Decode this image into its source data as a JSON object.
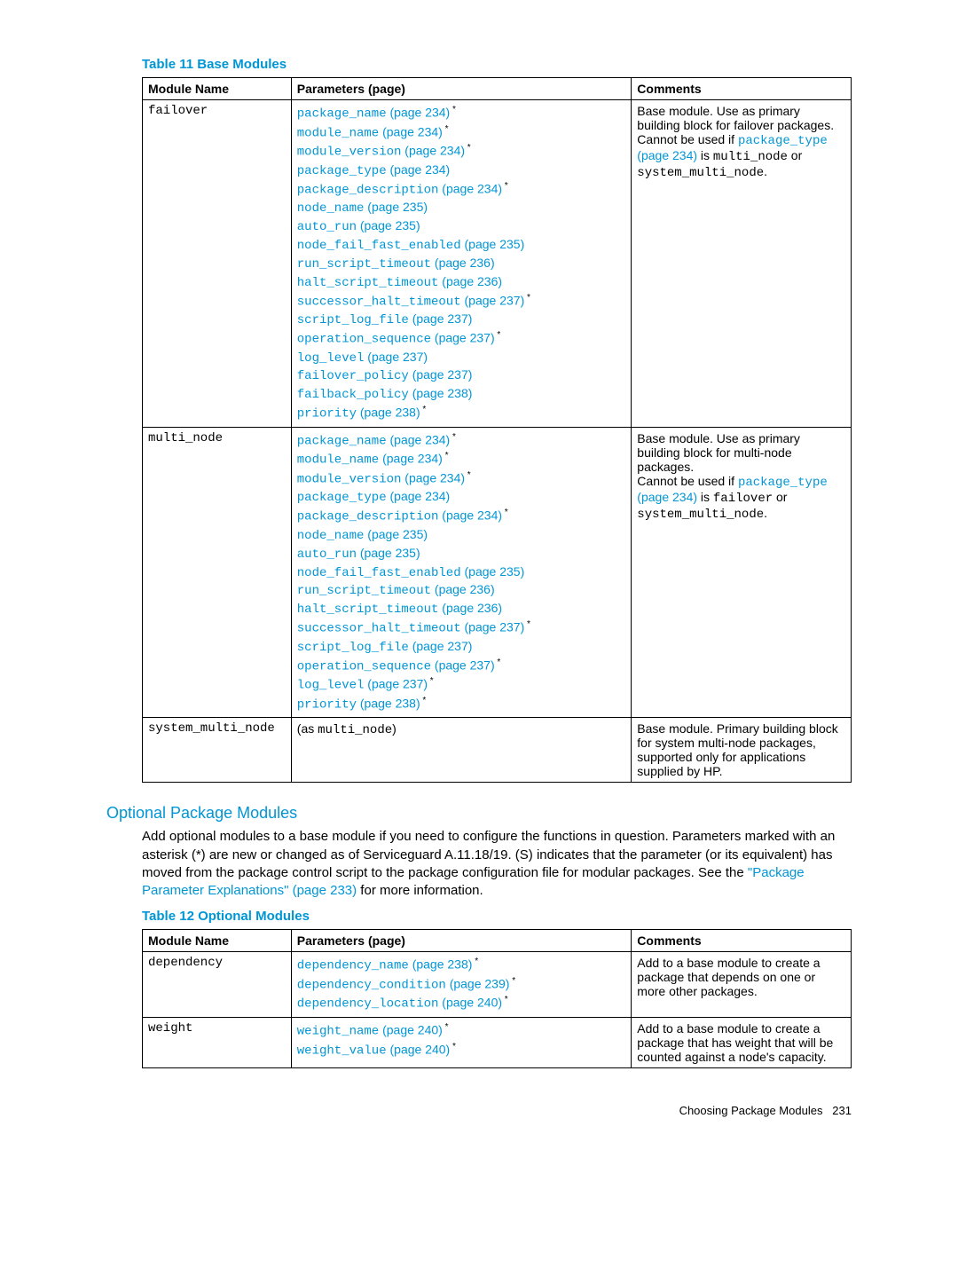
{
  "table11": {
    "title": "Table 11 Base Modules",
    "headers": [
      "Module Name",
      "Parameters (page)",
      "Comments"
    ],
    "rows": {
      "failover": {
        "module": "failover",
        "params": [
          {
            "name": "package_name",
            "page": "234",
            "star": true
          },
          {
            "name": "module_name",
            "page": "234",
            "star": true
          },
          {
            "name": "module_version",
            "page": "234",
            "star": true
          },
          {
            "name": "package_type",
            "page": "234"
          },
          {
            "name": "package_description",
            "page": "234",
            "star": true
          },
          {
            "name": "node_name",
            "page": "235"
          },
          {
            "name": "auto_run",
            "page": "235"
          },
          {
            "name": "node_fail_fast_enabled",
            "page": "235"
          },
          {
            "name": "run_script_timeout",
            "page": "236"
          },
          {
            "name": "halt_script_timeout",
            "page": "236"
          },
          {
            "name": "successor_halt_timeout",
            "page": "237",
            "star": true
          },
          {
            "name": "script_log_file",
            "page": "237"
          },
          {
            "name": "operation_sequence",
            "page": "237",
            "star": true
          },
          {
            "name": "log_level",
            "page": "237"
          },
          {
            "name": "failover_policy",
            "page": "237"
          },
          {
            "name": "failback_policy",
            "page": "238"
          },
          {
            "name": "priority",
            "page": "238",
            "star": true
          }
        ],
        "comment": {
          "pre": "Base module. Use as primary building block for failover packages.",
          "mid1": "Cannot be used if ",
          "link": "package_type",
          "linkpage": "(page 234)",
          "mid2": " is ",
          "c1": "multi_node",
          "mid3": " or ",
          "c2": "system_multi_node",
          "end": "."
        }
      },
      "multi_node": {
        "module": "multi_node",
        "params": [
          {
            "name": "package_name",
            "page": "234",
            "star": true
          },
          {
            "name": "module_name",
            "page": "234",
            "star": true
          },
          {
            "name": "module_version",
            "page": "234",
            "star": true
          },
          {
            "name": "package_type",
            "page": "234"
          },
          {
            "name": "package_description",
            "page": "234",
            "star": true
          },
          {
            "name": "node_name",
            "page": "235"
          },
          {
            "name": "auto_run",
            "page": "235"
          },
          {
            "name": "node_fail_fast_enabled",
            "page": "235"
          },
          {
            "name": "run_script_timeout",
            "page": "236"
          },
          {
            "name": "halt_script_timeout",
            "page": "236"
          },
          {
            "name": "successor_halt_timeout",
            "page": "237",
            "star": true
          },
          {
            "name": "script_log_file",
            "page": "237"
          },
          {
            "name": "operation_sequence",
            "page": "237",
            "star": true
          },
          {
            "name": "log_level",
            "page": "237",
            "star": true
          },
          {
            "name": "priority",
            "page": "238",
            "star": true
          }
        ],
        "comment": {
          "pre": "Base module. Use as primary building block for multi-node packages.",
          "mid1": "Cannot be used if ",
          "link": "package_type",
          "linkpage": "(page 234)",
          "mid2": " is ",
          "c1": "failover",
          "mid3": " or ",
          "c2": "system_multi_node",
          "end": "."
        }
      },
      "system_multi_node": {
        "module": "system_multi_node",
        "params_prefix": "(as ",
        "params_code": "multi_node",
        "params_suffix": ")",
        "comment": "Base module. Primary building block for system multi-node packages, supported only for applications supplied by HP."
      }
    }
  },
  "section": {
    "title": "Optional Package Modules",
    "text_pre": "Add optional modules to a base module if you need to configure the functions in question. Parameters marked with an asterisk (*) are new or changed as of Serviceguard A.11.18/19. (S) indicates that the parameter (or its equivalent) has moved from the package control script to the package configuration file for modular packages. See the ",
    "text_link": "\"Package Parameter Explanations\" (page 233)",
    "text_post": " for more information."
  },
  "table12": {
    "title": "Table 12 Optional Modules",
    "headers": [
      "Module Name",
      "Parameters (page)",
      "Comments"
    ],
    "rows": {
      "dependency": {
        "module": "dependency",
        "params": [
          {
            "name": "dependency_name",
            "page": "238",
            "star": true
          },
          {
            "name": "dependency_condition",
            "page": "239",
            "star": true
          },
          {
            "name": "dependency_location",
            "page": "240",
            "star": true
          }
        ],
        "comment": "Add to a base module to create a package that depends on one or more other packages."
      },
      "weight": {
        "module": "weight",
        "params": [
          {
            "name": "weight_name",
            "page": "240",
            "star": true
          },
          {
            "name": "weight_value",
            "page": "240",
            "star": true
          }
        ],
        "comment": "Add to a base module to create a package that has weight that will be counted against a node's capacity."
      }
    }
  },
  "footer": {
    "text": "Choosing Package Modules",
    "page": "231"
  },
  "labels": {
    "page_word": "page"
  }
}
